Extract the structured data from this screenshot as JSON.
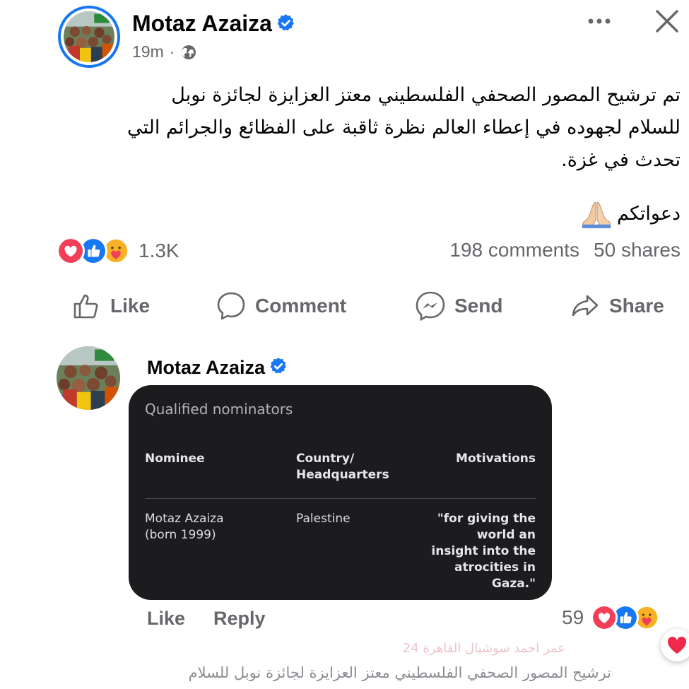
{
  "post": {
    "author": "Motaz Azaiza",
    "time": "19m",
    "dot": "·",
    "text": "تم ترشيح المصور الصحفي الفلسطيني معتز العزايزة لجائزة نوبل\nللسلام لجهوده في إعطاء العالم نظرة ثاقبة على الفظائع والجرائم التي\nتحدث في غزة.",
    "tail": "دعواتكم"
  },
  "stats": {
    "reactions": "1.3K",
    "comments": "198 comments",
    "shares": "50 shares"
  },
  "actions": {
    "like": "Like",
    "comment": "Comment",
    "send": "Send",
    "share": "Share"
  },
  "comment": {
    "author": "Motaz Azaiza",
    "card": {
      "title": "Qualified nominators",
      "headers": [
        "Nominee",
        "Country/\nHeadquarters",
        "Motivations"
      ],
      "row": [
        "Motaz Azaiza\n(born 1999)",
        "Palestine",
        "\"for giving the\nworld an\ninsight into the\natrocities in\nGaza.\""
      ]
    },
    "like": "Like",
    "reply": "Reply",
    "reactions": "59"
  },
  "next_comment": {
    "author": "عمر احمد سوشيال القاهرة 24",
    "text": "ترشيح المصور الصحفي الفلسطيني معتز العزايزة لجائزة نوبل للسلام"
  },
  "colors": {
    "brand": "#1877f2",
    "secondary_text": "#65676b",
    "love": "#f33e58",
    "care": "#f7b125",
    "card_bg": "#1c1c1e"
  },
  "icons": [
    "verified-badge-icon",
    "globe-icon",
    "more-icon",
    "close-icon",
    "folded-hands-emoji",
    "love-reaction-icon",
    "like-reaction-icon",
    "care-reaction-icon",
    "thumbs-up-icon",
    "comment-bubble-icon",
    "messenger-icon",
    "share-arrow-icon",
    "heart-icon"
  ]
}
